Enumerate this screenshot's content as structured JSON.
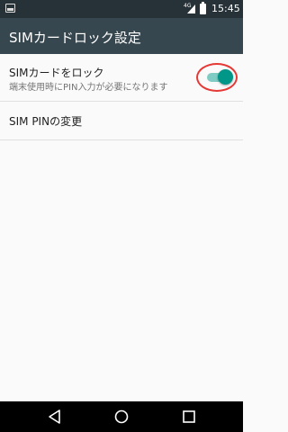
{
  "status_bar": {
    "network": "4G",
    "time": "15:45",
    "icons": [
      "notification-icon",
      "signal-icon",
      "battery-icon"
    ]
  },
  "app_bar": {
    "title": "SIMカードロック設定"
  },
  "preferences": {
    "lock_sim": {
      "title": "SIMカードをロック",
      "summary": "端末使用時にPIN入力が必要になります",
      "enabled": true
    },
    "change_pin": {
      "title": "SIM PINの変更"
    }
  },
  "nav_bar": {
    "buttons": [
      "back-icon",
      "home-icon",
      "recents-icon"
    ]
  },
  "colors": {
    "status_bar": "#263238",
    "app_bar": "#37474f",
    "accent": "#009688",
    "highlight": "#e53935"
  }
}
